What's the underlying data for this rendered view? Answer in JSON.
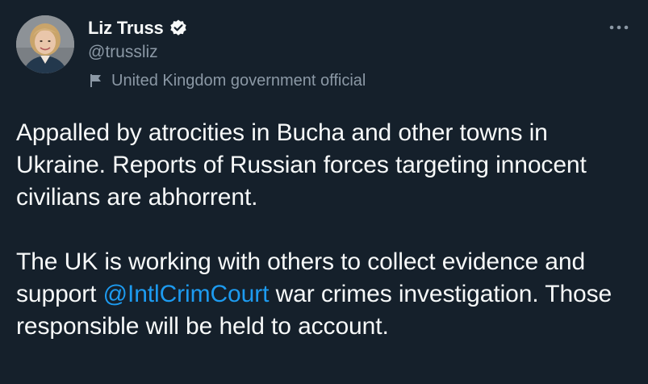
{
  "author": {
    "display_name": "Liz Truss",
    "handle": "@trussliz",
    "verified": true,
    "label": "United Kingdom government official",
    "avatar_icon": "profile-photo"
  },
  "actions": {
    "more_icon": "more-horizontal-icon"
  },
  "tweet": {
    "paragraph1": "Appalled by atrocities in Bucha and other towns in Ukraine. Reports of Russian forces targeting innocent civilians are abhorrent.",
    "paragraph2_before": "The UK is working with others to collect evidence and support ",
    "mention": "@IntlCrimCourt",
    "paragraph2_after": " war crimes investigation. Those responsible will be held to account."
  },
  "colors": {
    "background": "#15202b",
    "text": "#f7f9f9",
    "secondary": "#8b98a5",
    "accent": "#1d9bf0"
  }
}
